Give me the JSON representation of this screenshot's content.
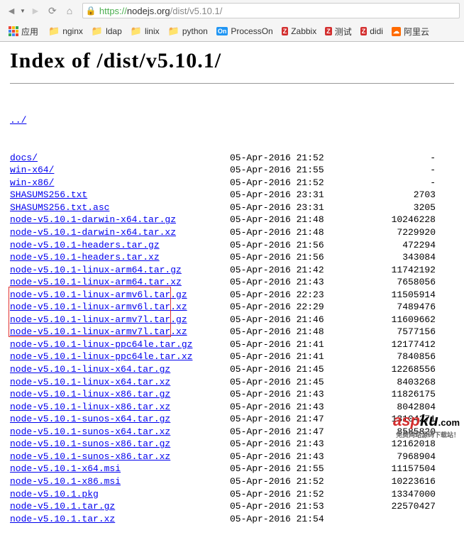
{
  "browser": {
    "url_protocol": "https://",
    "url_host": "nodejs.org",
    "url_path": "/dist/v5.10.1/"
  },
  "bookmarks": {
    "apps": "应用",
    "items": [
      {
        "label": "nginx",
        "icon": "folder"
      },
      {
        "label": "ldap",
        "icon": "folder"
      },
      {
        "label": "linix",
        "icon": "folder"
      },
      {
        "label": "python",
        "icon": "folder"
      },
      {
        "label": "ProcessOn",
        "icon": "on"
      },
      {
        "label": "Zabbix",
        "icon": "zr"
      },
      {
        "label": "测试",
        "icon": "zr"
      },
      {
        "label": "didi",
        "icon": "zr"
      },
      {
        "label": "阿里云",
        "icon": "ali"
      }
    ]
  },
  "page": {
    "title": "Index of /dist/v5.10.1/",
    "parent_link": "../",
    "rows": [
      {
        "name": "docs/",
        "date": "05-Apr-2016 21:52",
        "size": "-"
      },
      {
        "name": "win-x64/",
        "date": "05-Apr-2016 21:55",
        "size": "-"
      },
      {
        "name": "win-x86/",
        "date": "05-Apr-2016 21:52",
        "size": "-"
      },
      {
        "name": "SHASUMS256.txt",
        "date": "05-Apr-2016 23:31",
        "size": "2703"
      },
      {
        "name": "SHASUMS256.txt.asc",
        "date": "05-Apr-2016 23:31",
        "size": "3205"
      },
      {
        "name": "node-v5.10.1-darwin-x64.tar.gz",
        "date": "05-Apr-2016 21:48",
        "size": "10246228"
      },
      {
        "name": "node-v5.10.1-darwin-x64.tar.xz",
        "date": "05-Apr-2016 21:48",
        "size": "7229920"
      },
      {
        "name": "node-v5.10.1-headers.tar.gz",
        "date": "05-Apr-2016 21:56",
        "size": "472294"
      },
      {
        "name": "node-v5.10.1-headers.tar.xz",
        "date": "05-Apr-2016 21:56",
        "size": "343084"
      },
      {
        "name": "node-v5.10.1-linux-arm64.tar.gz",
        "date": "05-Apr-2016 21:42",
        "size": "11742192"
      },
      {
        "name": "node-v5.10.1-linux-arm64.tar.xz",
        "date": "05-Apr-2016 21:43",
        "size": "7658056"
      },
      {
        "name": "node-v5.10.1-linux-armv6l.tar.gz",
        "date": "05-Apr-2016 22:23",
        "size": "11505914"
      },
      {
        "name": "node-v5.10.1-linux-armv6l.tar.xz",
        "date": "05-Apr-2016 22:29",
        "size": "7489476"
      },
      {
        "name": "node-v5.10.1-linux-armv7l.tar.gz",
        "date": "05-Apr-2016 21:46",
        "size": "11609662"
      },
      {
        "name": "node-v5.10.1-linux-armv7l.tar.xz",
        "date": "05-Apr-2016 21:48",
        "size": "7577156"
      },
      {
        "name": "node-v5.10.1-linux-ppc64le.tar.gz",
        "date": "05-Apr-2016 21:41",
        "size": "12177412"
      },
      {
        "name": "node-v5.10.1-linux-ppc64le.tar.xz",
        "date": "05-Apr-2016 21:41",
        "size": "7840856"
      },
      {
        "name": "node-v5.10.1-linux-x64.tar.gz",
        "date": "05-Apr-2016 21:45",
        "size": "12268556"
      },
      {
        "name": "node-v5.10.1-linux-x64.tar.xz",
        "date": "05-Apr-2016 21:45",
        "size": "8403268"
      },
      {
        "name": "node-v5.10.1-linux-x86.tar.gz",
        "date": "05-Apr-2016 21:43",
        "size": "11826175"
      },
      {
        "name": "node-v5.10.1-linux-x86.tar.xz",
        "date": "05-Apr-2016 21:43",
        "size": "8042804"
      },
      {
        "name": "node-v5.10.1-sunos-x64.tar.gz",
        "date": "05-Apr-2016 21:47",
        "size": "13104271"
      },
      {
        "name": "node-v5.10.1-sunos-x64.tar.xz",
        "date": "05-Apr-2016 21:47",
        "size": "8585820"
      },
      {
        "name": "node-v5.10.1-sunos-x86.tar.gz",
        "date": "05-Apr-2016 21:43",
        "size": "12162018"
      },
      {
        "name": "node-v5.10.1-sunos-x86.tar.xz",
        "date": "05-Apr-2016 21:43",
        "size": "7968904"
      },
      {
        "name": "node-v5.10.1-x64.msi",
        "date": "05-Apr-2016 21:55",
        "size": "11157504"
      },
      {
        "name": "node-v5.10.1-x86.msi",
        "date": "05-Apr-2016 21:52",
        "size": "10223616"
      },
      {
        "name": "node-v5.10.1.pkg",
        "date": "05-Apr-2016 21:52",
        "size": "13347000"
      },
      {
        "name": "node-v5.10.1.tar.gz",
        "date": "05-Apr-2016 21:53",
        "size": "22570427"
      },
      {
        "name": "node-v5.10.1.tar.xz",
        "date": "05-Apr-2016 21:54",
        "size": ""
      }
    ]
  },
  "watermark": {
    "brand_red": "asp",
    "brand_black": "ku",
    "brand_com": ".com",
    "subtitle": "免费网站源码下载站！"
  }
}
